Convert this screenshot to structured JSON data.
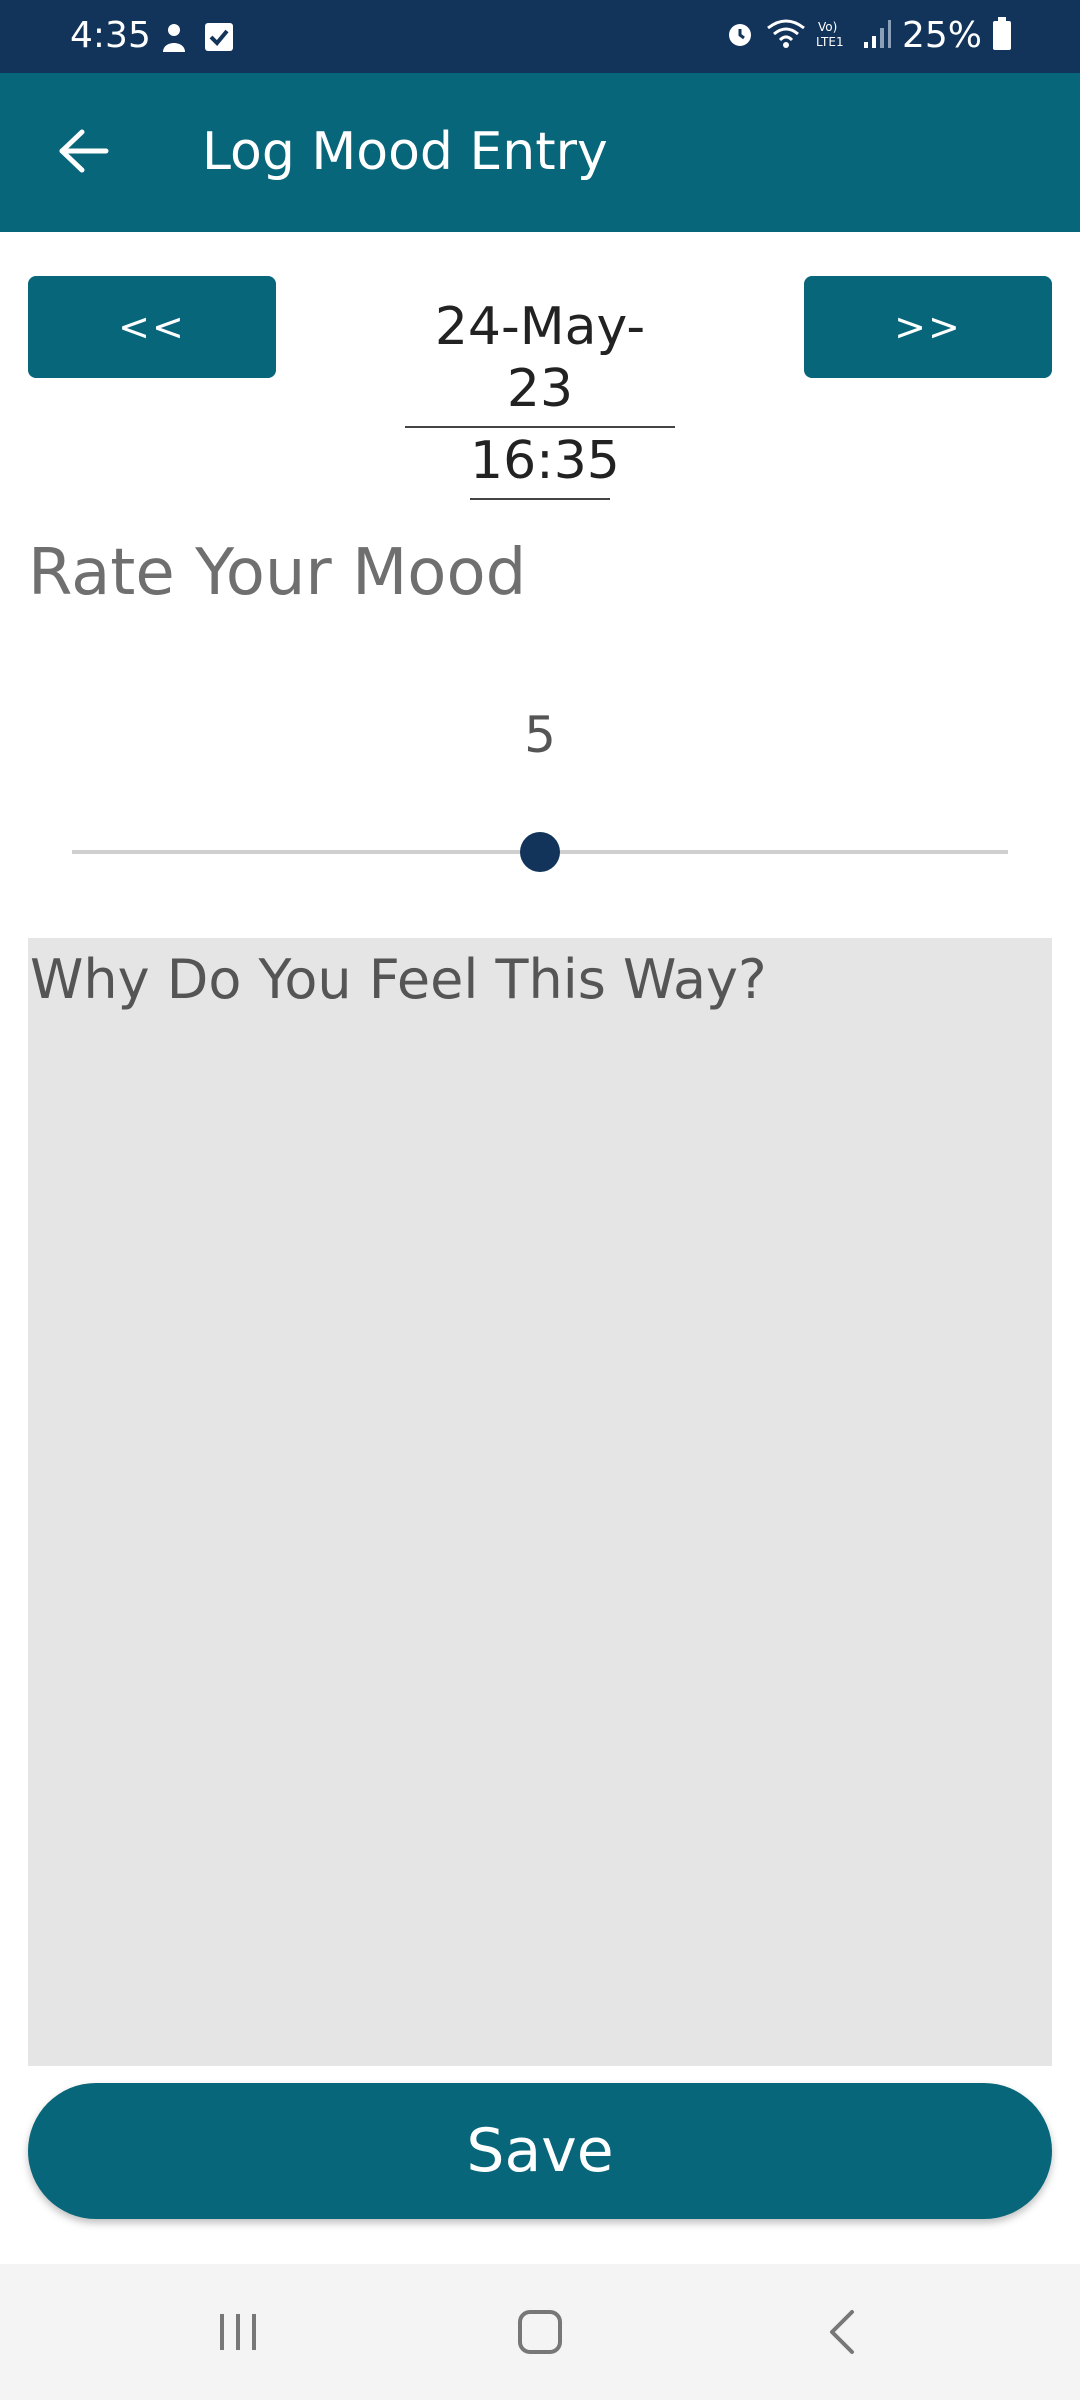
{
  "status_bar": {
    "time": "4:35",
    "battery": "25%",
    "left_icons": [
      "user-icon",
      "checkbox-icon"
    ],
    "right_icons": [
      "alarm-icon",
      "wifi-icon",
      "volte-icon",
      "signal-icon",
      "battery-icon"
    ]
  },
  "app_bar": {
    "title": "Log Mood Entry",
    "back_icon": "back-arrow-icon"
  },
  "date_nav": {
    "prev_label": "<<",
    "next_label": ">>",
    "date": "24-May-23",
    "time": "16:35"
  },
  "mood": {
    "label": "Rate Your Mood",
    "value": "5",
    "slider_fraction": 0.5
  },
  "feeling": {
    "placeholder": "Why Do You Feel This Way?"
  },
  "save_label": "Save",
  "system_nav": {
    "items": [
      "recents-icon",
      "home-icon",
      "back-icon"
    ]
  },
  "colors": {
    "status_bar": "#12335a",
    "accent": "#07667a",
    "slider_thumb": "#12335a",
    "text_box_bg": "#e5e5e5"
  }
}
